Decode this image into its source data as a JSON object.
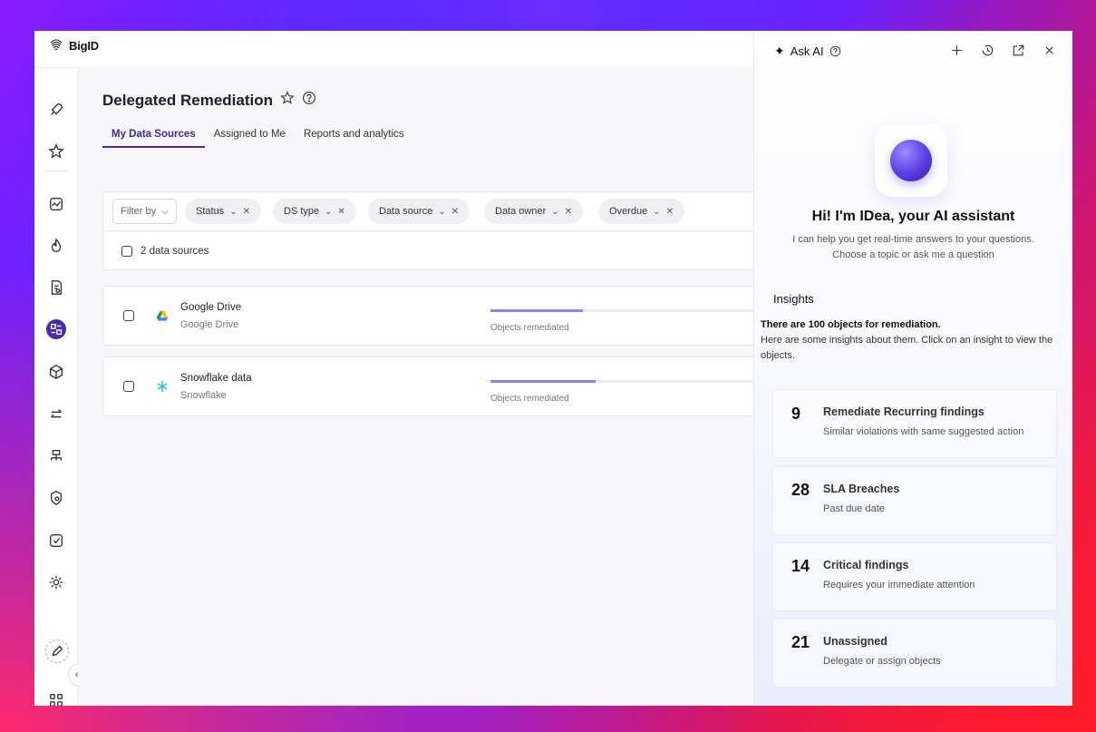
{
  "app": {
    "logo_text": "BigID"
  },
  "page": {
    "title": "Delegated Remediation",
    "tabs": [
      {
        "label": "My Data Sources",
        "active": true
      },
      {
        "label": "Assigned to Me",
        "active": false
      },
      {
        "label": "Reports and analytics",
        "active": false
      }
    ]
  },
  "filters": {
    "filter_by_label": "Filter by",
    "chips": [
      "Status",
      "DS type",
      "Data source",
      "Data owner",
      "Overdue"
    ]
  },
  "data_sources": {
    "count_label": "2 data sources",
    "items": [
      {
        "name": "Google Drive",
        "type": "Google Drive",
        "progress_label": "Objects remediated",
        "progress": 0.35,
        "icon": "google-drive-icon"
      },
      {
        "name": "Snowflake data",
        "type": "Snowflake",
        "progress_label": "Objects remediated",
        "progress": 0.4,
        "icon": "snowflake-icon"
      }
    ]
  },
  "ai_panel": {
    "title": "Ask AI",
    "greeting": "Hi! I'm IDea, your AI assistant",
    "sub_line1": "I can help you get real-time answers to your questions.",
    "sub_line2": "Choose a topic or ask me a question",
    "insights_title": "Insights",
    "insights_intro_bold": "There are 100 objects for remediation.",
    "insights_intro_rest": "Here are some insights about them. Click on an insight to view the objects.",
    "insights": [
      {
        "count": "9",
        "title": "Remediate Recurring findings",
        "desc": "Similar violations with same suggested action"
      },
      {
        "count": "28",
        "title": "SLA Breaches",
        "desc": "Past due date"
      },
      {
        "count": "14",
        "title": "Critical findings",
        "desc": "Requires your immediate attention"
      },
      {
        "count": "21",
        "title": "Unassigned",
        "desc": "Delegate or assign objects"
      }
    ]
  },
  "colors": {
    "accent": "#4a2ca8",
    "progress": "#9a7bea"
  }
}
